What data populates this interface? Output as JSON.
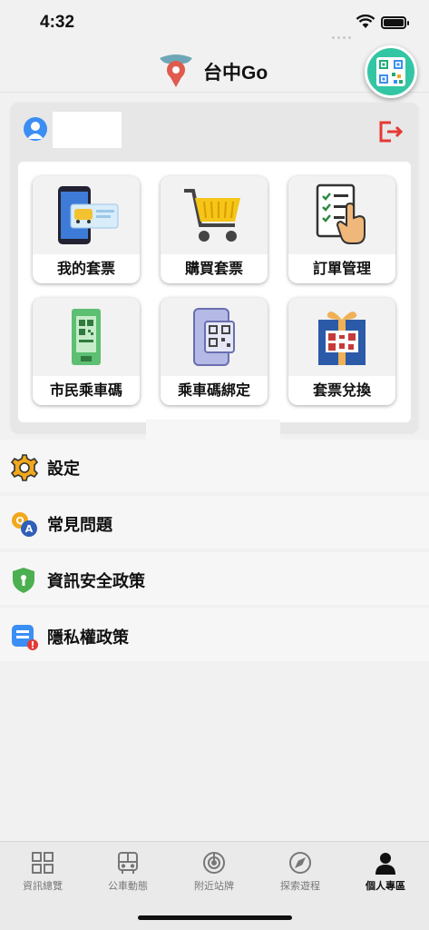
{
  "status": {
    "time": "4:32"
  },
  "header": {
    "title": "台中Go"
  },
  "profile": {
    "user_name": ""
  },
  "tiles": [
    {
      "label": "我的套票",
      "icon": "phone-ticket-icon"
    },
    {
      "label": "購買套票",
      "icon": "shopping-cart-icon"
    },
    {
      "label": "訂單管理",
      "icon": "order-list-icon"
    },
    {
      "label": "市民乘車碼",
      "icon": "citizen-qr-icon"
    },
    {
      "label": "乘車碼綁定",
      "icon": "phone-qr-icon"
    },
    {
      "label": "套票兌換",
      "icon": "gift-qr-icon"
    }
  ],
  "menu": [
    {
      "label": "設定",
      "icon": "gear-icon"
    },
    {
      "label": "常見問題",
      "icon": "faq-icon"
    },
    {
      "label": "資訊安全政策",
      "icon": "shield-icon"
    },
    {
      "label": "隱私權政策",
      "icon": "privacy-doc-icon"
    }
  ],
  "tabbar": [
    {
      "label": "資訊總覽",
      "icon": "grid-icon",
      "active": false
    },
    {
      "label": "公車動態",
      "icon": "bus-icon",
      "active": false
    },
    {
      "label": "附近站牌",
      "icon": "nearby-icon",
      "active": false
    },
    {
      "label": "探索遊程",
      "icon": "compass-icon",
      "active": false
    },
    {
      "label": "個人專區",
      "icon": "person-icon",
      "active": true
    }
  ],
  "colors": {
    "accent": "#34c6a4",
    "avatar": "#3b8ef3",
    "logout": "#e53935"
  }
}
